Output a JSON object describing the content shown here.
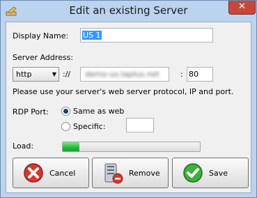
{
  "window": {
    "title": "Edit an existing Server",
    "close_label": "✕"
  },
  "form": {
    "display_name_label": "Display Name:",
    "display_name_value": "US 1",
    "server_address_label": "Server Address:",
    "protocol_value": "http",
    "scheme_separator": "://",
    "host_value": "demo-us.taplus.net",
    "port_separator": ":",
    "port_value": "80",
    "hint": "Please use your server's web server protocol, IP and port.",
    "rdp_port_label": "RDP Port:",
    "rdp_same_label": "Same as web",
    "rdp_specific_label": "Specific:",
    "rdp_specific_value": "",
    "rdp_selected": "same",
    "load_label": "Load:",
    "load_fraction": 0.12
  },
  "buttons": {
    "cancel": "Cancel",
    "remove": "Remove",
    "save": "Save"
  },
  "icons": {
    "app": "pencil-icon",
    "cancel": "red-x-icon",
    "remove": "server-remove-icon",
    "save": "green-check-icon"
  },
  "colors": {
    "title_bar": "#bcd3ef",
    "close": "#c7473b",
    "selection": "#3399ff",
    "progress": "#1fbf3a"
  }
}
